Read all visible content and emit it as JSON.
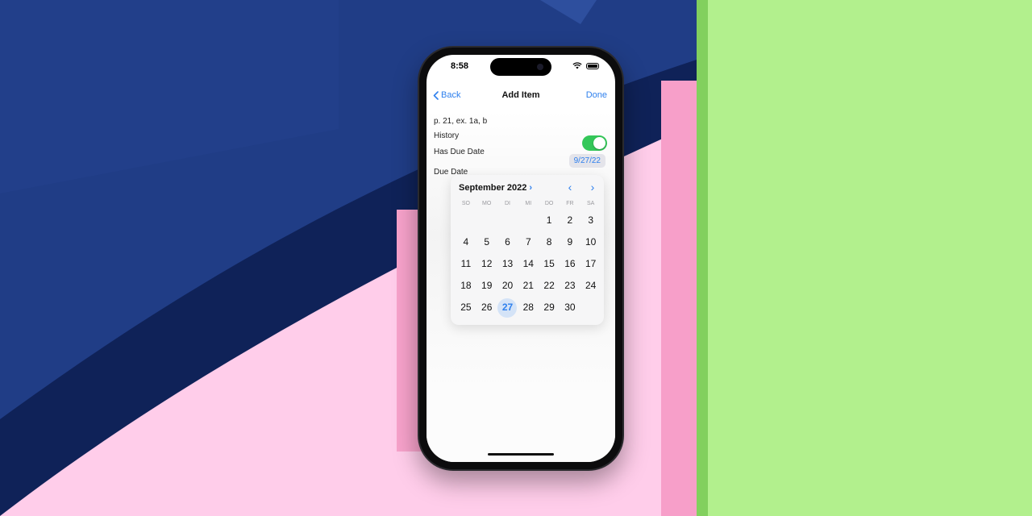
{
  "status_bar": {
    "time": "8:58"
  },
  "nav": {
    "back_label": "Back",
    "title": "Add Item",
    "done_label": "Done"
  },
  "form": {
    "item_text": "p. 21, ex. 1a, b",
    "subject": "History",
    "has_due_date_label": "Has Due Date",
    "has_due_date_on": true,
    "due_date_label": "Due Date",
    "due_date_value": "9/27/22"
  },
  "calendar": {
    "month_label": "September 2022",
    "weekdays": [
      "SO",
      "MO",
      "DI",
      "MI",
      "DO",
      "FR",
      "SA"
    ],
    "days": [
      "",
      "",
      "",
      "",
      "1",
      "2",
      "3",
      "4",
      "5",
      "6",
      "7",
      "8",
      "9",
      "10",
      "11",
      "12",
      "13",
      "14",
      "15",
      "16",
      "17",
      "18",
      "19",
      "20",
      "21",
      "22",
      "23",
      "24",
      "25",
      "26",
      "27",
      "28",
      "29",
      "30",
      ""
    ],
    "selected_day": "27"
  },
  "colors": {
    "accent": "#2f80ed",
    "toggle_on": "#34c759"
  }
}
